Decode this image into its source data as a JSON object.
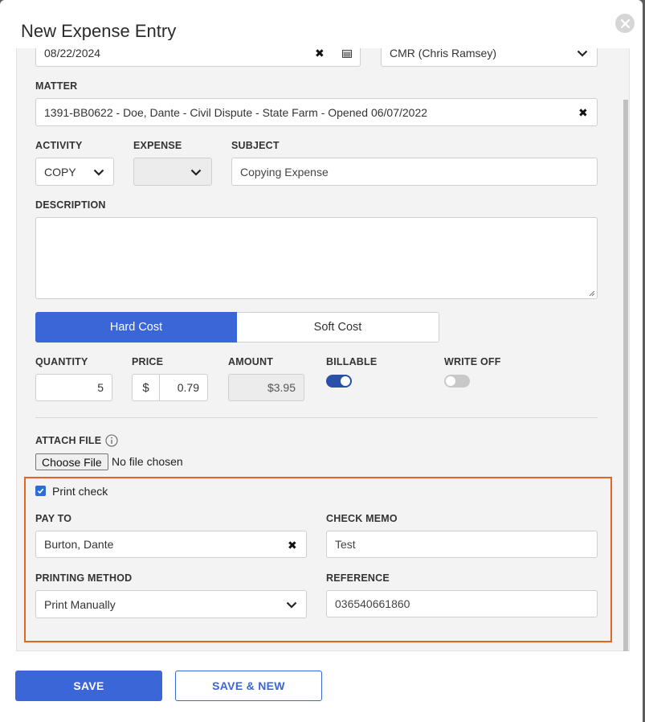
{
  "modal": {
    "title": "New Expense Entry"
  },
  "top_row": {
    "date_value": "08/22/2024",
    "user_value": "CMR (Chris Ramsey)"
  },
  "matter": {
    "label": "MATTER",
    "value": "1391-BB0622 - Doe, Dante - Civil Dispute - State Farm - Opened 06/07/2022"
  },
  "activity": {
    "label": "ACTIVITY",
    "value": "COPY"
  },
  "expense": {
    "label": "EXPENSE",
    "value": ""
  },
  "subject": {
    "label": "SUBJECT",
    "value": "Copying Expense"
  },
  "description": {
    "label": "DESCRIPTION",
    "value": ""
  },
  "cost_type": {
    "hard": "Hard Cost",
    "soft": "Soft Cost",
    "selected": "Hard Cost"
  },
  "quantity": {
    "label": "QUANTITY",
    "value": "5"
  },
  "price": {
    "label": "PRICE",
    "currency": "$",
    "value": "0.79"
  },
  "amount": {
    "label": "AMOUNT",
    "value": "$3.95"
  },
  "billable": {
    "label": "BILLABLE",
    "on": true
  },
  "write_off": {
    "label": "WRITE OFF",
    "on": false
  },
  "attach": {
    "label": "ATTACH FILE",
    "button": "Choose File",
    "status": "No file chosen"
  },
  "print_check": {
    "label": "Print check",
    "checked": true
  },
  "pay_to": {
    "label": "PAY TO",
    "value": "Burton, Dante"
  },
  "check_memo": {
    "label": "CHECK MEMO",
    "value": "Test"
  },
  "printing_method": {
    "label": "PRINTING METHOD",
    "value": "Print Manually"
  },
  "reference": {
    "label": "REFERENCE",
    "value": "036540661860"
  },
  "footer": {
    "save": "SAVE",
    "save_new": "SAVE & NEW"
  },
  "colors": {
    "primary": "#3a66d8",
    "highlight": "#e2661f",
    "toggle_on": "#2a4fa8",
    "toggle_off": "#c8c8c8"
  }
}
